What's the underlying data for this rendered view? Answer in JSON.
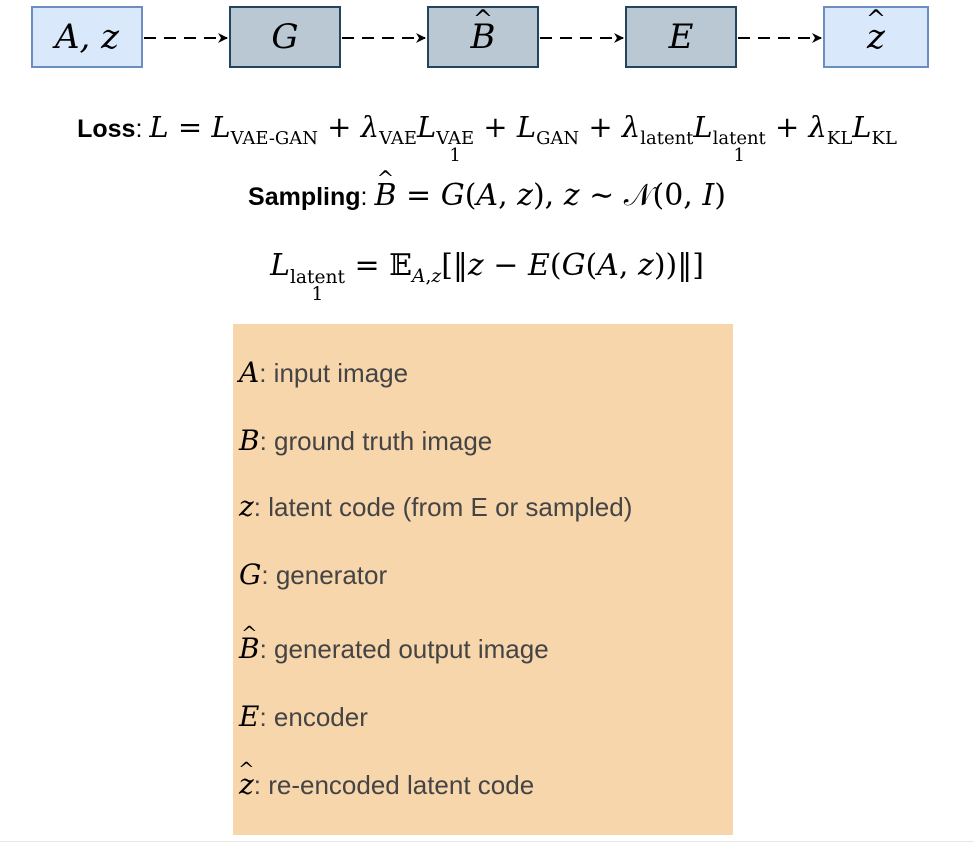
{
  "flow": {
    "nodes": [
      {
        "label": "A, z",
        "style": "input"
      },
      {
        "label": "G",
        "style": "model"
      },
      {
        "label": "B",
        "hat": true,
        "style": "model"
      },
      {
        "label": "E",
        "style": "model"
      },
      {
        "label": "z",
        "hat": true,
        "style": "input"
      }
    ],
    "edges": [
      {
        "from": "A, z",
        "to": "G",
        "style": "dashed-arrow"
      },
      {
        "from": "G",
        "to": "B̂",
        "style": "dashed-arrow"
      },
      {
        "from": "B̂",
        "to": "E",
        "style": "dashed-arrow"
      },
      {
        "from": "E",
        "to": "ẑ",
        "style": "dashed-arrow"
      }
    ],
    "colors": {
      "input_fill": "#dae8fc",
      "input_border": "#6c8ebf",
      "model_fill": "#bac8d3",
      "model_border": "#23445d",
      "legend_fill": "#f8d6ac"
    }
  },
  "equations": {
    "loss_label": "Loss",
    "loss_expr": "L = L_VAE-GAN + λ_VAE L_1^VAE + L_GAN + λ_latent L_1^latent + λ_KL L_KL",
    "sampling_label": "Sampling",
    "sampling_expr": "B̂ = G(A, z), z ∼ 𝒩(0, I)",
    "latent_expr": "L_1^latent = 𝔼_A,z [‖z − E(G(A, z))‖]"
  },
  "legend": [
    {
      "symbol": "A",
      "desc": ": input image"
    },
    {
      "symbol": "B",
      "desc": ": ground truth image"
    },
    {
      "symbol": "z",
      "desc": ": latent code (from E or sampled)"
    },
    {
      "symbol": "G",
      "desc": ": generator"
    },
    {
      "symbol": "B",
      "hat": true,
      "desc": ": generated output image"
    },
    {
      "symbol": "E",
      "desc": ": encoder"
    },
    {
      "symbol": "z",
      "hat": true,
      "desc": ": re-encoded latent code"
    }
  ]
}
